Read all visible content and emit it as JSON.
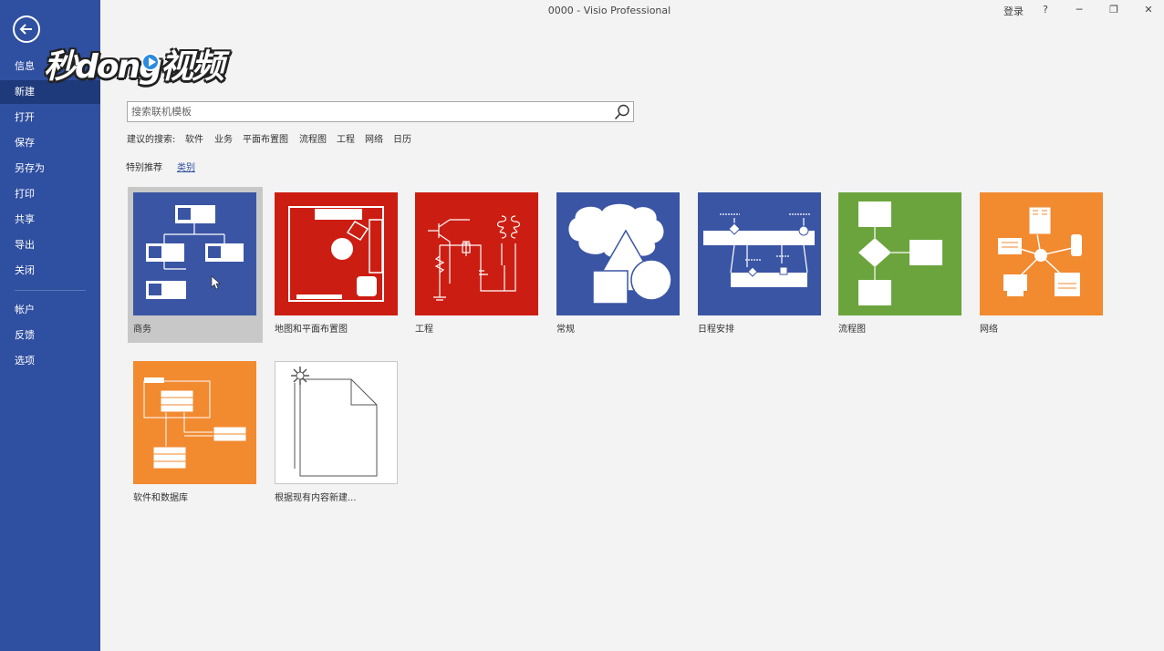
{
  "window": {
    "title": "0000  -  Visio Professional",
    "sign_in": "登录",
    "help": "?",
    "minimize": "─",
    "restore": "❐",
    "close": "✕"
  },
  "sidebar": {
    "items": [
      {
        "label": "信息"
      },
      {
        "label": "新建"
      },
      {
        "label": "打开"
      },
      {
        "label": "保存"
      },
      {
        "label": "另存为"
      },
      {
        "label": "打印"
      },
      {
        "label": "共享"
      },
      {
        "label": "导出"
      },
      {
        "label": "关闭"
      },
      {
        "label": "帐户"
      },
      {
        "label": "反馈"
      },
      {
        "label": "选项"
      }
    ],
    "active": "新建"
  },
  "watermark": {
    "text": "秒dong视频"
  },
  "search": {
    "placeholder": "搜索联机模板",
    "suggested_label": "建议的搜索:",
    "suggestions": [
      "软件",
      "业务",
      "平面布置图",
      "流程图",
      "工程",
      "网络",
      "日历"
    ]
  },
  "filters": {
    "featured": "特别推荐",
    "categories": "类别"
  },
  "templates": [
    {
      "label": "商务",
      "color": "#3a55a4"
    },
    {
      "label": "地图和平面布置图",
      "color": "#cc1d12"
    },
    {
      "label": "工程",
      "color": "#cc1d12"
    },
    {
      "label": "常规",
      "color": "#3a55a4"
    },
    {
      "label": "日程安排",
      "color": "#3a55a4"
    },
    {
      "label": "流程图",
      "color": "#6ba43c"
    },
    {
      "label": "网络",
      "color": "#f28a30"
    },
    {
      "label": "软件和数据库",
      "color": "#f28a30"
    },
    {
      "label": "根据现有内容新建...",
      "color": "#ffffff"
    }
  ],
  "colors": {
    "sidebar": "#2f4fa0",
    "sidebar_active": "#1e3a7b",
    "accent": "#2f4fa0"
  }
}
